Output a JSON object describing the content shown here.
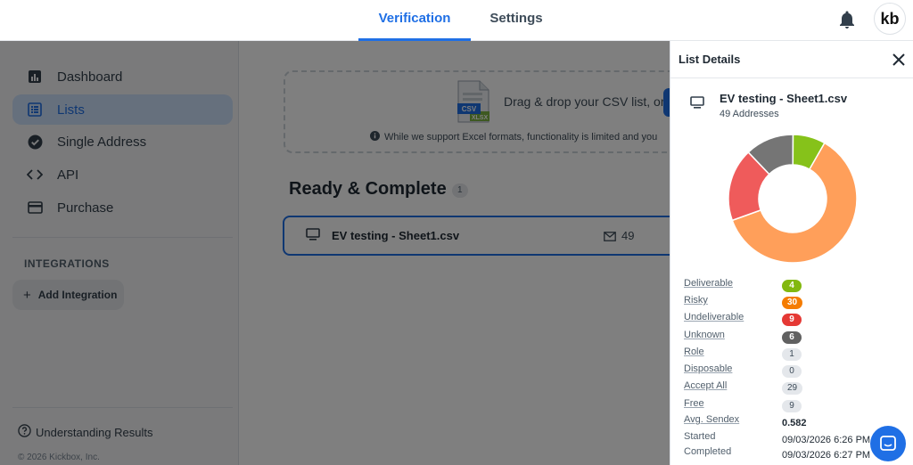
{
  "topbar": {
    "tabs": [
      {
        "label": "Verification",
        "active": true
      },
      {
        "label": "Settings",
        "active": false
      }
    ],
    "avatar_text": "kb"
  },
  "sidebar": {
    "items": [
      {
        "label": "Dashboard",
        "icon": "bar-chart-icon",
        "active": false
      },
      {
        "label": "Lists",
        "icon": "list-icon",
        "active": true
      },
      {
        "label": "Single Address",
        "icon": "check-circle-icon",
        "active": false
      },
      {
        "label": "API",
        "icon": "code-icon",
        "active": false
      },
      {
        "label": "Purchase",
        "icon": "credit-card-icon",
        "active": false
      }
    ],
    "integrations_label": "INTEGRATIONS",
    "add_integration": "Add Integration",
    "understanding_results": "Understanding Results",
    "copyright": "© 2026 Kickbox, Inc."
  },
  "main": {
    "dropzone": {
      "file_badge_csv": "CSV",
      "file_badge_xlsx": "XLSX",
      "text": "Drag & drop your CSV list, or",
      "note": "While we support Excel formats, functionality is limited and you"
    },
    "section_title": "Ready & Complete",
    "section_count": "1",
    "list": {
      "name": "EV testing - Sheet1.csv",
      "count": "49"
    }
  },
  "panel": {
    "title": "List Details",
    "file_name": "EV testing - Sheet1.csv",
    "file_sub": "49 Addresses",
    "stats": [
      {
        "label": "Deliverable",
        "value": "4",
        "pill": "#82b80f"
      },
      {
        "label": "Risky",
        "value": "30",
        "pill": "#f57c00"
      },
      {
        "label": "Undeliverable",
        "value": "9",
        "pill": "#e53935"
      },
      {
        "label": "Unknown",
        "value": "6",
        "pill": "#616161"
      },
      {
        "label": "Role",
        "value": "1",
        "pill": "gray"
      },
      {
        "label": "Disposable",
        "value": "0",
        "pill": "gray"
      },
      {
        "label": "Accept All",
        "value": "29",
        "pill": "gray"
      },
      {
        "label": "Free",
        "value": "9",
        "pill": "gray"
      }
    ],
    "sendex_label": "Avg. Sendex",
    "sendex_value": "0.582",
    "started_label": "Started",
    "started_value": "09/03/2026 6:26 PM",
    "completed_label": "Completed",
    "completed_value": "09/03/2026 6:27 PM"
  },
  "chart_data": {
    "type": "pie",
    "categories": [
      "Risky",
      "Undeliverable",
      "Unknown",
      "Deliverable"
    ],
    "values": [
      30,
      9,
      6,
      4
    ],
    "colors": [
      "#ff9f5a",
      "#ef5b5b",
      "#757575",
      "#86c21a"
    ],
    "title": "",
    "donut": true
  }
}
